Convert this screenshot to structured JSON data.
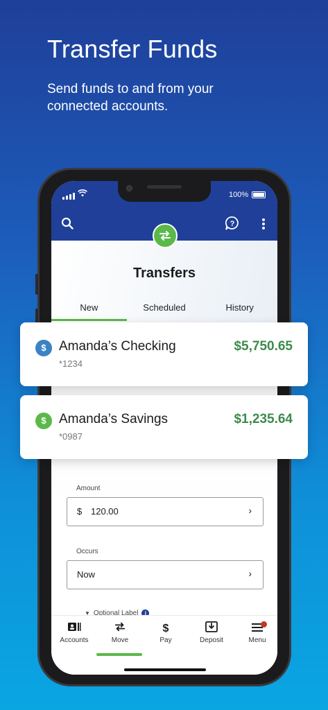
{
  "hero": {
    "title": "Transfer Funds",
    "subtitle": "Send funds to and from your connected accounts."
  },
  "status_bar": {
    "battery_text": "100%"
  },
  "header": {
    "icons": [
      "search-icon",
      "transfer-icon",
      "help-chat-icon",
      "more-vertical-icon"
    ]
  },
  "page": {
    "title": "Transfers",
    "tabs": [
      {
        "label": "New",
        "active": true
      },
      {
        "label": "Scheduled",
        "active": false
      },
      {
        "label": "History",
        "active": false
      }
    ]
  },
  "accounts": [
    {
      "name": "Amanda’s Checking",
      "number": "*1234",
      "balance": "$5,750.65",
      "icon_color": "#3b82c4"
    },
    {
      "name": "Amanda’s Savings",
      "number": "*0987",
      "balance": "$1,235.64",
      "icon_color": "#5bb94a"
    }
  ],
  "form": {
    "amount_label": "Amount",
    "amount_currency": "$",
    "amount_value": "120.00",
    "occurs_label": "Occurs",
    "occurs_value": "Now",
    "optional_label": "Optional Label"
  },
  "tab_bar": {
    "items": [
      {
        "label": "Accounts",
        "icon": "accounts-icon"
      },
      {
        "label": "Move",
        "icon": "move-icon",
        "active": true
      },
      {
        "label": "Pay",
        "icon": "dollar-icon"
      },
      {
        "label": "Deposit",
        "icon": "deposit-icon"
      },
      {
        "label": "Menu",
        "icon": "menu-icon",
        "badge": true
      }
    ]
  },
  "colors": {
    "brand_blue": "#1f3f99",
    "accent_green": "#5bb94a",
    "amount_green": "#3d8a4c",
    "badge_red": "#c0392b"
  }
}
